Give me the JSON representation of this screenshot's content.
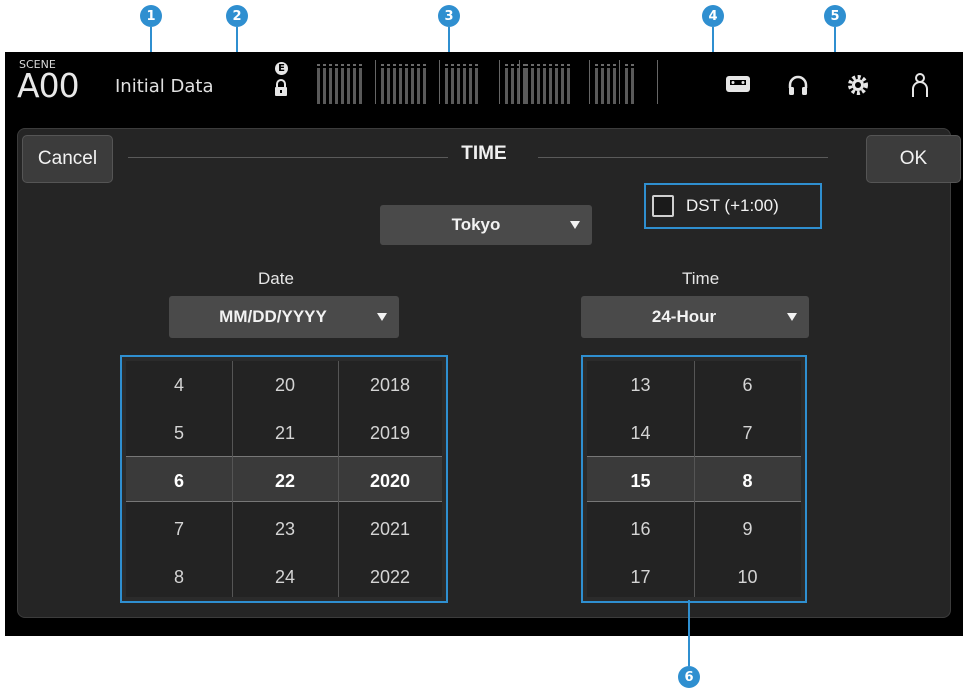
{
  "callouts": [
    "1",
    "2",
    "3",
    "4",
    "5",
    "6"
  ],
  "header": {
    "scene_label": "SCENE",
    "scene_number": "A00",
    "scene_name": "Initial Data",
    "edit_badge": "E"
  },
  "dialog": {
    "title": "TIME",
    "cancel_label": "Cancel",
    "ok_label": "OK",
    "timezone": "Tokyo",
    "dst_label": "DST (+1:00)",
    "dst_checked": false,
    "date_label": "Date",
    "date_format": "MM/DD/YYYY",
    "time_label": "Time",
    "time_format": "24-Hour"
  },
  "date_picker": {
    "columns": [
      {
        "name": "month",
        "values": [
          "4",
          "5",
          "6",
          "7",
          "8"
        ],
        "selected": "6"
      },
      {
        "name": "day",
        "values": [
          "20",
          "21",
          "22",
          "23",
          "24"
        ],
        "selected": "22"
      },
      {
        "name": "year",
        "values": [
          "2018",
          "2019",
          "2020",
          "2021",
          "2022"
        ],
        "selected": "2020"
      }
    ]
  },
  "time_picker": {
    "columns": [
      {
        "name": "hour",
        "values": [
          "13",
          "14",
          "15",
          "16",
          "17"
        ],
        "selected": "15"
      },
      {
        "name": "minute",
        "values": [
          "6",
          "7",
          "8",
          "9",
          "10"
        ],
        "selected": "8"
      }
    ]
  },
  "colors": {
    "accent": "#2f8fd0",
    "panel": "#252525",
    "dropdown": "#4a4a4a"
  }
}
